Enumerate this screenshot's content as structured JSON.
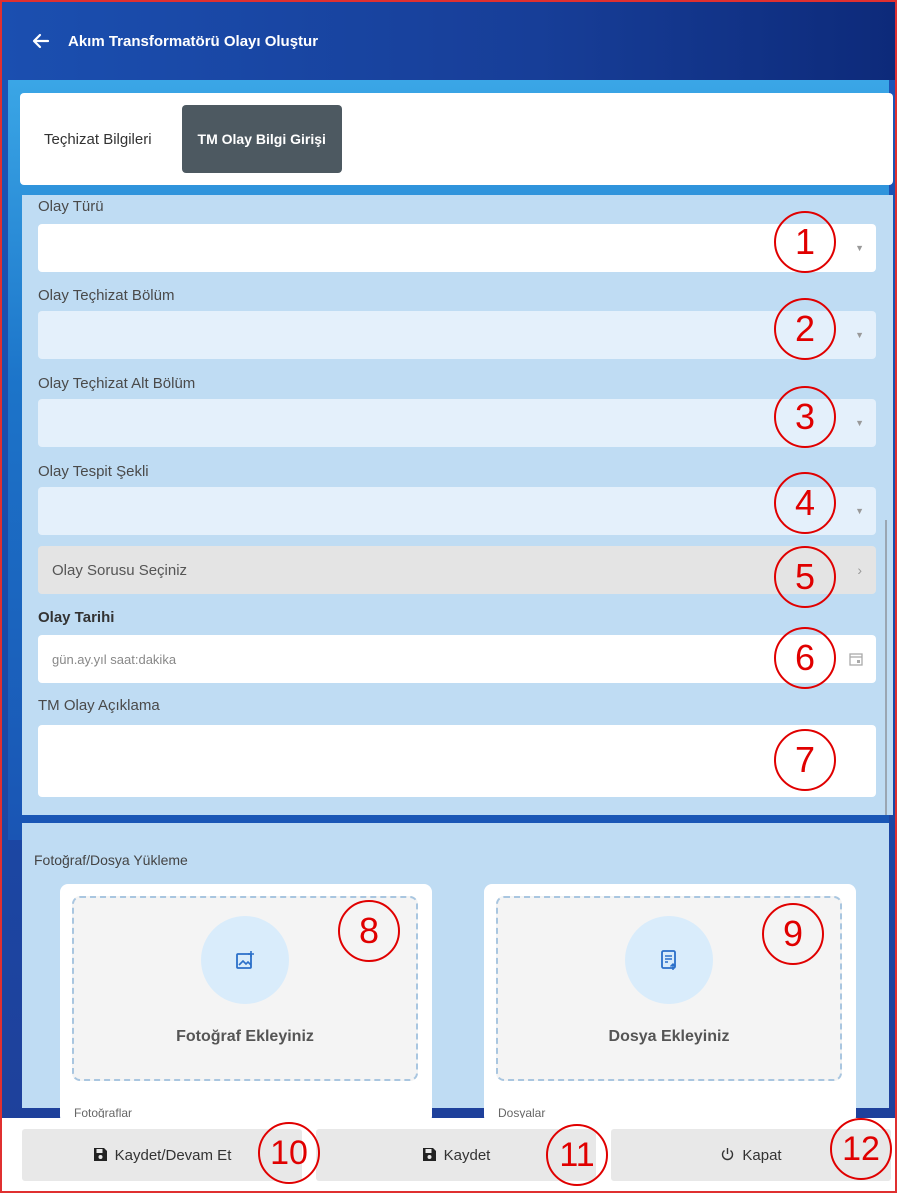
{
  "header": {
    "title": "Akım Transformatörü Olayı Oluştur"
  },
  "tabs": [
    {
      "label": "Teçhizat Bilgileri"
    },
    {
      "label": "TM Olay Bilgi Girişi"
    }
  ],
  "form": {
    "olay_turu": {
      "label": "Olay Türü",
      "value": ""
    },
    "olay_techizat_bolum": {
      "label": "Olay Teçhizat Bölüm",
      "value": ""
    },
    "olay_techizat_alt_bolum": {
      "label": "Olay Teçhizat Alt Bölüm",
      "value": ""
    },
    "olay_tespit_sekli": {
      "label": "Olay Tespit Şekli",
      "value": ""
    },
    "olay_sorusu": {
      "placeholder": "Olay Sorusu Seçiniz"
    },
    "olay_tarihi": {
      "label": "Olay Tarihi",
      "placeholder": "gün.ay.yıl saat:dakika"
    },
    "tm_olay_aciklama": {
      "label": "TM Olay Açıklama",
      "value": ""
    }
  },
  "upload": {
    "title": "Fotoğraf/Dosya Yükleme",
    "photo": {
      "label": "Fotoğraf Ekleyiniz",
      "list_label": "Fotoğraflar"
    },
    "file": {
      "label": "Dosya Ekleyiniz",
      "list_label": "Dosyalar"
    }
  },
  "footer": {
    "save_continue": "Kaydet/Devam Et",
    "save": "Kaydet",
    "close": "Kapat"
  },
  "callouts": [
    "1",
    "2",
    "3",
    "4",
    "5",
    "6",
    "7",
    "8",
    "9",
    "10",
    "11",
    "12"
  ],
  "colors": {
    "header_blue": "#173e98",
    "panel_light_blue": "#bfdcf3",
    "active_tab": "#4d5961",
    "callout_red": "#e00000"
  }
}
